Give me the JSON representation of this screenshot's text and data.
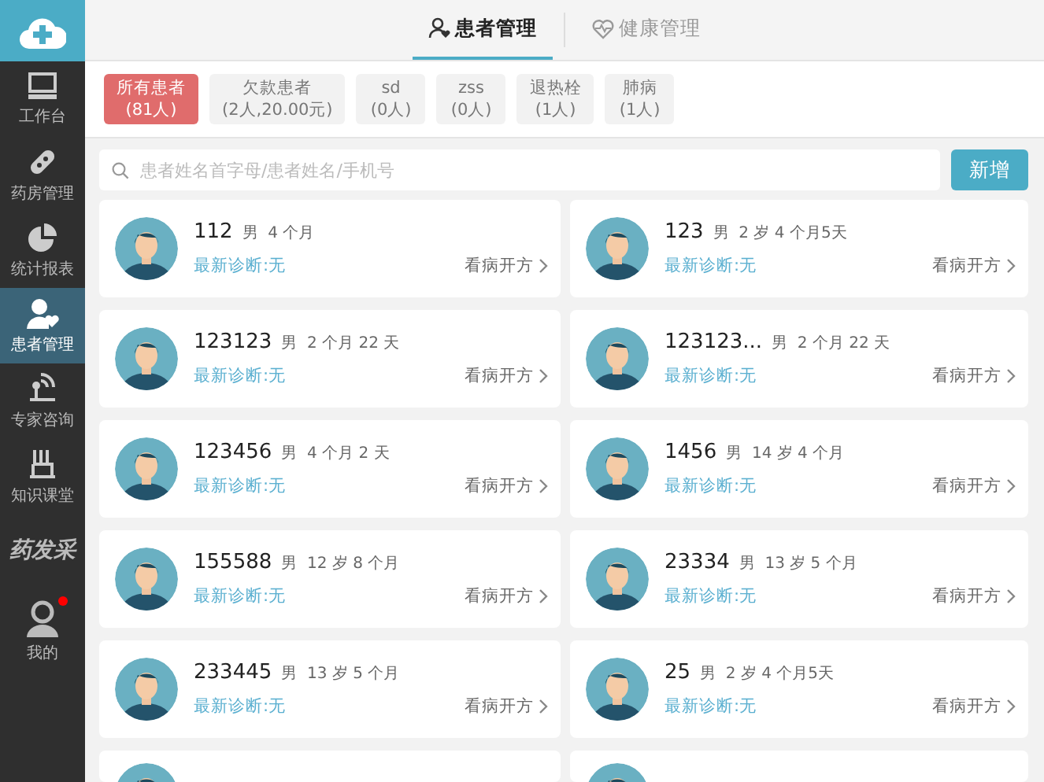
{
  "sidebar": {
    "items": [
      {
        "kind": "desk",
        "label": "工作台",
        "selected": false,
        "badge": false
      },
      {
        "kind": "pill",
        "label": "药房管理",
        "selected": false,
        "badge": false
      },
      {
        "kind": "chart",
        "label": "统计报表",
        "selected": false,
        "badge": false
      },
      {
        "kind": "patient",
        "label": "患者管理",
        "selected": true,
        "badge": false
      },
      {
        "kind": "expert",
        "label": "专家咨询",
        "selected": false,
        "badge": false
      },
      {
        "kind": "class",
        "label": "知识课堂",
        "selected": false,
        "badge": false
      },
      {
        "kind": "brand",
        "label": "药发采",
        "selected": false,
        "badge": false
      },
      {
        "kind": "user",
        "label": "我的",
        "selected": false,
        "badge": true
      }
    ]
  },
  "tabs": [
    {
      "kind": "patient",
      "label": "患者管理",
      "selected": true
    },
    {
      "kind": "health",
      "label": "健康管理",
      "selected": false
    }
  ],
  "filters": [
    {
      "name": "所有患者",
      "count": "(81人)",
      "selected": true
    },
    {
      "name": "欠款患者",
      "count": "(2人,20.00元)",
      "selected": false
    },
    {
      "name": "sd",
      "count": "(0人)",
      "selected": false
    },
    {
      "name": "zss",
      "count": "(0人)",
      "selected": false
    },
    {
      "name": "退热栓",
      "count": "(1人)",
      "selected": false
    },
    {
      "name": "肺病",
      "count": "(1人)",
      "selected": false
    }
  ],
  "search": {
    "placeholder": "患者姓名首字母/患者姓名/手机号"
  },
  "add_button": "新增",
  "patients": [
    {
      "kind": "full",
      "name": "112",
      "info": "男  4 个月",
      "diagnosis": "最新诊断:无",
      "action": "看病开方"
    },
    {
      "kind": "full",
      "name": "123",
      "info": "男  2 岁 4 个月5天",
      "diagnosis": "最新诊断:无",
      "action": "看病开方"
    },
    {
      "kind": "full",
      "name": "123123",
      "info": "男  2 个月 22 天",
      "diagnosis": "最新诊断:无",
      "action": "看病开方"
    },
    {
      "kind": "full",
      "name": "123123...",
      "info": "男  2 个月 22 天",
      "diagnosis": "最新诊断:无",
      "action": "看病开方"
    },
    {
      "kind": "full",
      "name": "123456",
      "info": "男  4 个月 2 天",
      "diagnosis": "最新诊断:无",
      "action": "看病开方"
    },
    {
      "kind": "full",
      "name": "1456",
      "info": "男  14 岁 4 个月",
      "diagnosis": "最新诊断:无",
      "action": "看病开方"
    },
    {
      "kind": "full",
      "name": "155588",
      "info": "男  12 岁 8 个月",
      "diagnosis": "最新诊断:无",
      "action": "看病开方"
    },
    {
      "kind": "full",
      "name": "23334",
      "info": "男  13 岁 5 个月",
      "diagnosis": "最新诊断:无",
      "action": "看病开方"
    },
    {
      "kind": "full",
      "name": "233445",
      "info": "男  13 岁 5 个月",
      "diagnosis": "最新诊断:无",
      "action": "看病开方"
    },
    {
      "kind": "full",
      "name": "25",
      "info": "男  2 岁 4 个月5天",
      "diagnosis": "最新诊断:无",
      "action": "看病开方"
    },
    {
      "kind": "cut"
    },
    {
      "kind": "cut"
    }
  ]
}
